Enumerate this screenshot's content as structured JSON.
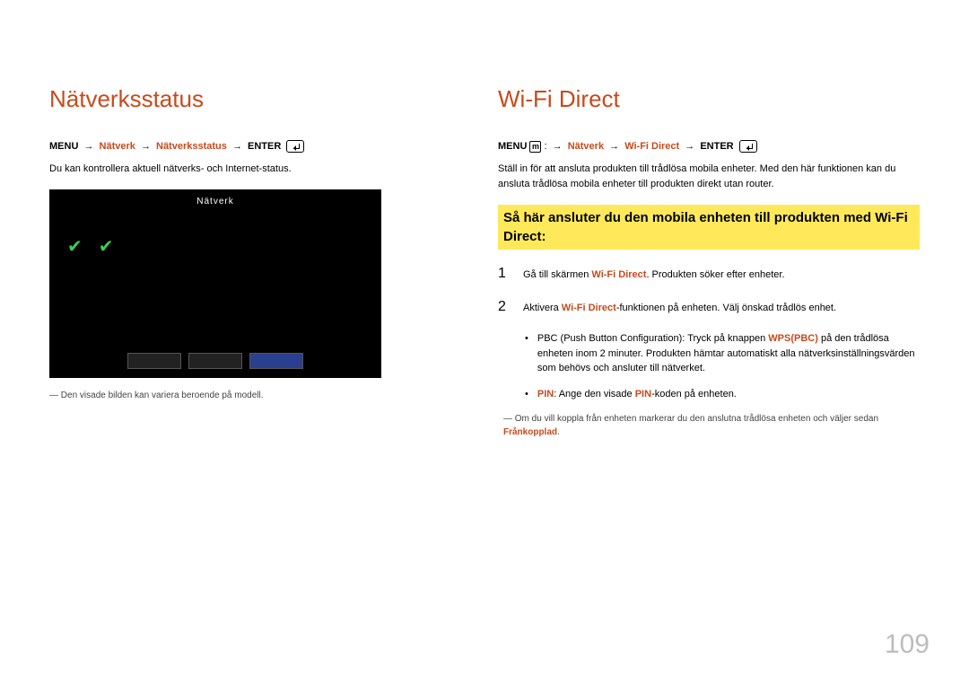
{
  "left": {
    "title": "Nätverksstatus",
    "path": {
      "menu_label": "MENU",
      "seg1": "Nätverk",
      "seg2": "Nätverksstatus",
      "enter_label": "ENTER"
    },
    "desc": "Du kan kontrollera aktuell nätverks- och Internet-status.",
    "screenshot": {
      "title": "Nätverk",
      "labels_col": [
        "",
        "",
        "",
        ""
      ],
      "right_col": [
        "",
        "",
        "",
        "",
        "",
        ""
      ],
      "lower": [
        "",
        ""
      ]
    },
    "caption": "Den visade bilden kan variera beroende på modell."
  },
  "right": {
    "title": "Wi-Fi Direct",
    "path": {
      "menu_label": "MENU",
      "m_glyph": "m",
      "colon": ":",
      "seg1": "Nätverk",
      "seg2": "Wi-Fi Direct",
      "enter_label": "ENTER"
    },
    "desc": "Ställ in för att ansluta produkten till trådlösa mobila enheter. Med den här funktionen kan du ansluta trådlösa mobila enheter till produkten direkt utan router.",
    "subheading": "Så här ansluter du den mobila enheten till produkten med Wi-Fi Direct:",
    "step1_num": "1",
    "step1_a": "Gå till skärmen ",
    "step1_hl": "Wi-Fi Direct",
    "step1_b": ". Produkten söker efter enheter.",
    "step2_num": "2",
    "step2_a": "Aktivera ",
    "step2_hl": "Wi-Fi Direct",
    "step2_b": "-funktionen på enheten. Välj önskad trådlös enhet.",
    "bullet1_a": "PBC (Push Button Configuration): Tryck på knappen ",
    "bullet1_hl": "WPS(PBC)",
    "bullet1_b": " på den trådlösa enheten inom 2 minuter. Produkten hämtar automatiskt alla nätverksinställningsvärden som behövs och ansluter till nätverket.",
    "bullet2_hl1": "PIN",
    "bullet2_a": ": Ange den visade ",
    "bullet2_hl2": "PIN",
    "bullet2_b": "-koden på enheten.",
    "footnote_a": "Om du vill koppla från enheten markerar du den anslutna trådlösa enheten och väljer sedan ",
    "footnote_hl": "Frånkopplad",
    "footnote_b": "."
  },
  "page_number": "109"
}
